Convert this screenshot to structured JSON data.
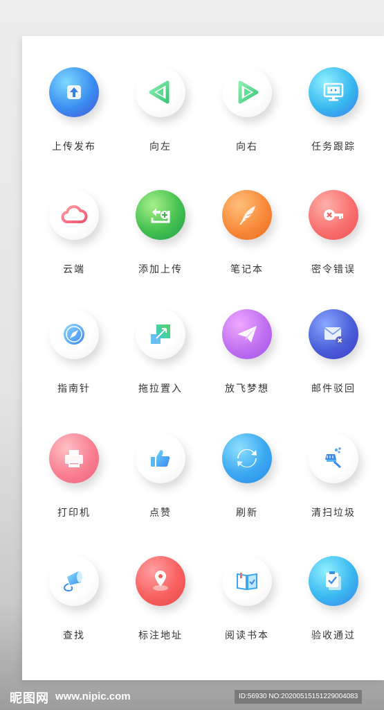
{
  "icons": [
    {
      "label": "上传发布",
      "icon": "upload-icon"
    },
    {
      "label": "向左",
      "icon": "arrow-left-icon"
    },
    {
      "label": "向右",
      "icon": "arrow-right-icon"
    },
    {
      "label": "任务跟踪",
      "icon": "monitor-icon"
    },
    {
      "label": "云端",
      "icon": "cloud-icon"
    },
    {
      "label": "添加上传",
      "icon": "add-upload-icon"
    },
    {
      "label": "笔记本",
      "icon": "feather-icon"
    },
    {
      "label": "密令错误",
      "icon": "key-error-icon"
    },
    {
      "label": "指南针",
      "icon": "compass-icon"
    },
    {
      "label": "拖拉置入",
      "icon": "drag-drop-icon"
    },
    {
      "label": "放飞梦想",
      "icon": "paper-plane-icon"
    },
    {
      "label": "邮件驳回",
      "icon": "mail-reject-icon"
    },
    {
      "label": "打印机",
      "icon": "printer-icon"
    },
    {
      "label": "点赞",
      "icon": "thumbs-up-icon"
    },
    {
      "label": "刷新",
      "icon": "refresh-icon"
    },
    {
      "label": "清扫垃圾",
      "icon": "broom-icon"
    },
    {
      "label": "查找",
      "icon": "megaphone-icon"
    },
    {
      "label": "标注地址",
      "icon": "location-pin-icon"
    },
    {
      "label": "阅读书本",
      "icon": "book-icon"
    },
    {
      "label": "验收通过",
      "icon": "clipboard-check-icon"
    }
  ],
  "footer": {
    "logo": "昵图网",
    "site": "www.nipic.com",
    "id": "ID:56930 NO:20200515151229004083"
  }
}
